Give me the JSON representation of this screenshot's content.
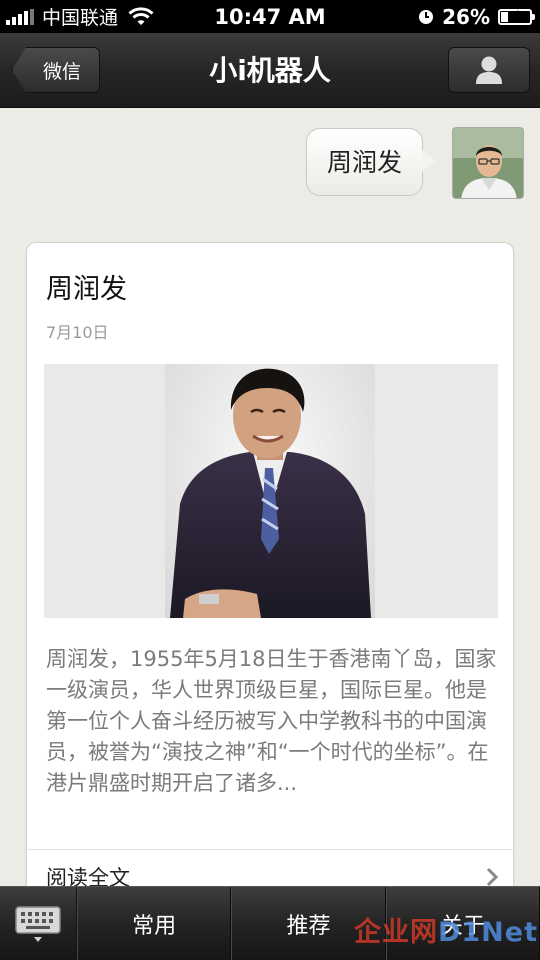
{
  "status_bar": {
    "carrier": "中国联通",
    "time": "10:47 AM",
    "battery": "26%",
    "battery_level": 0.26
  },
  "nav": {
    "back_label": "微信",
    "title": "小i机器人",
    "profile_icon": "person-icon"
  },
  "chat": {
    "sent_message": "周润发"
  },
  "article": {
    "title": "周润发",
    "date": "7月10日",
    "summary": "周润发，1955年5月18日生于香港南丫岛，国家一级演员，华人世界顶级巨星，国际巨星。他是第一位个人奋斗经历被写入中学教科书的中国演员，被誉为“演技之神”和“一个时代的坐标”。在港片鼎盛时期开启了诸多...",
    "read_more": "阅读全文"
  },
  "bottom_menu": {
    "keyboard_icon": "keyboard-icon",
    "tabs": [
      "常用",
      "推荐",
      "关于"
    ]
  },
  "watermark": {
    "cn": "企业网",
    "en": "D1Net"
  },
  "colors": {
    "nav_background": "#262626",
    "chat_background": "#ecebe6",
    "summary_text": "#7b7b7b",
    "watermark_red": "#e63c28",
    "watermark_blue": "#508cdc"
  }
}
